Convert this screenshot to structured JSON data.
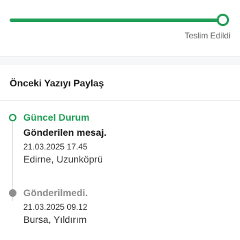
{
  "tracking": {
    "progress_percent": 100,
    "status": "Teslim Edildi",
    "accent_color": "#1f9d55"
  },
  "share": {
    "title": "Önceki Yazıyı Paylaş"
  },
  "timeline": [
    {
      "title": "Güncel Durum",
      "message": "Gönderilen mesaj.",
      "date": "21.03.2025 17.45",
      "location": "Edirne, Uzunköprü",
      "icon": "circle-outline-icon"
    },
    {
      "title": "Gönderilmedi.",
      "date": "21.03.2025 09.12",
      "location": "Bursa, Yıldırım",
      "icon": "check-circle-icon"
    }
  ]
}
